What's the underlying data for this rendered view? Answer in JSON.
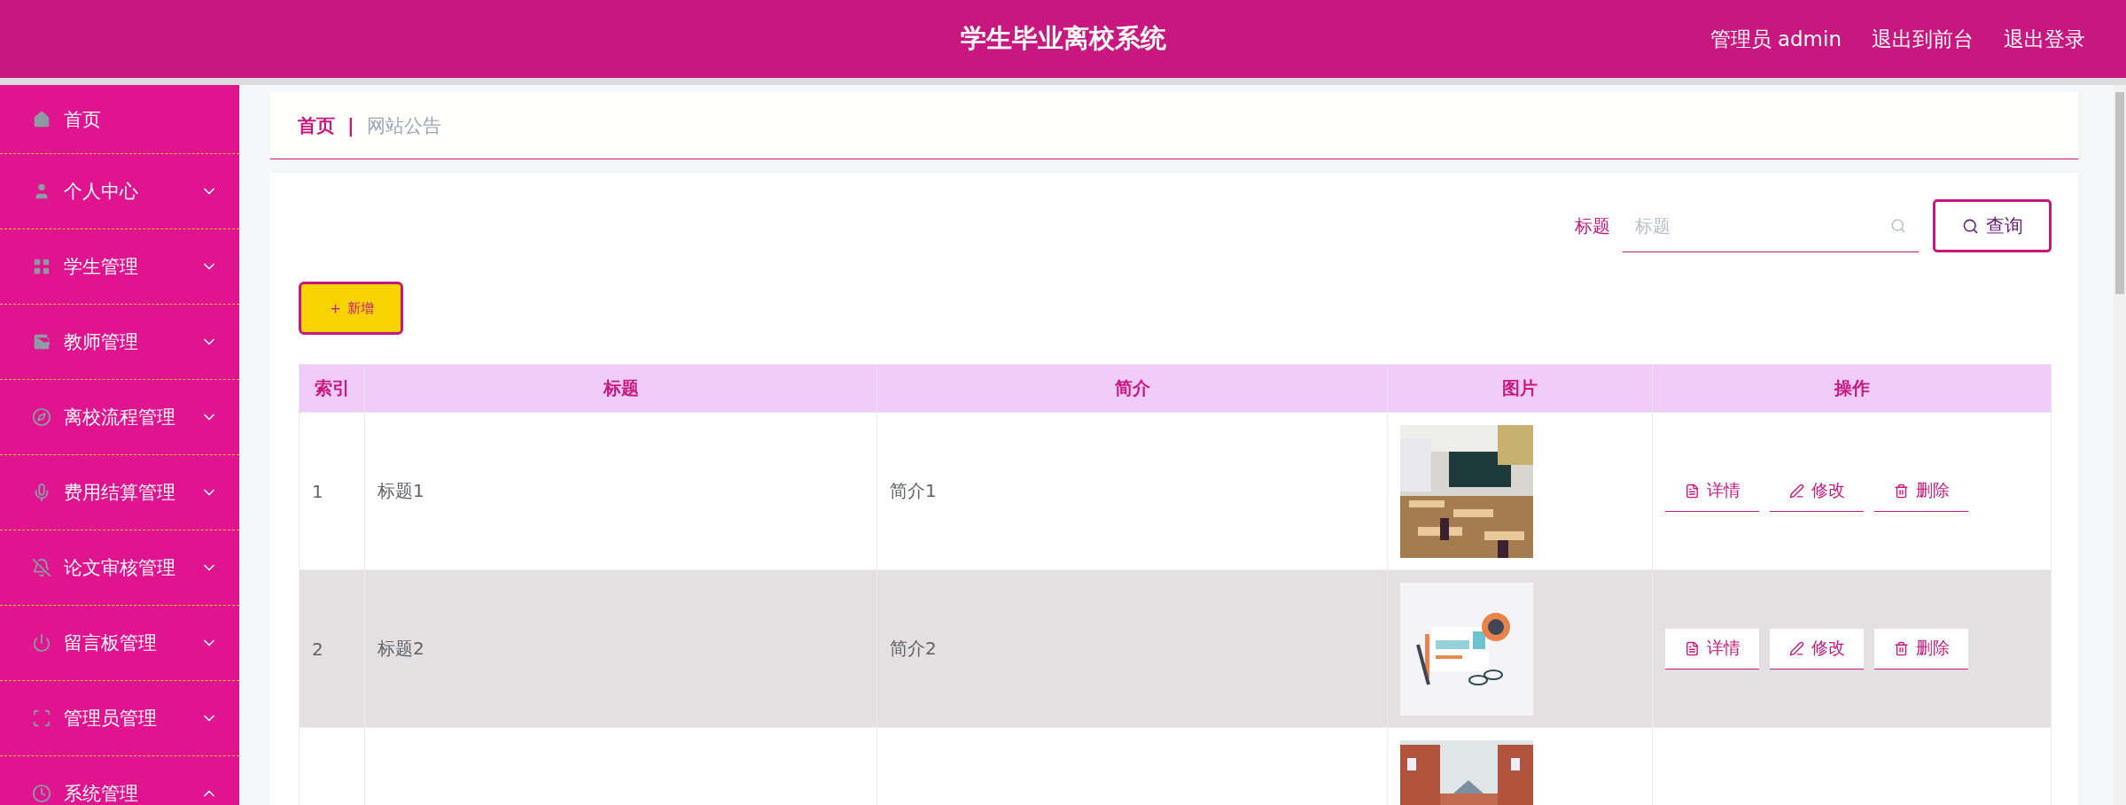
{
  "header": {
    "title": "学生毕业离校系统",
    "links": [
      "管理员 admin",
      "退出到前台",
      "退出登录"
    ]
  },
  "sidebar": {
    "items": [
      {
        "label": "首页",
        "kind": "link"
      },
      {
        "label": "个人中心",
        "kind": "submenu",
        "expanded": false
      },
      {
        "label": "学生管理",
        "kind": "submenu",
        "expanded": false
      },
      {
        "label": "教师管理",
        "kind": "submenu",
        "expanded": false
      },
      {
        "label": "离校流程管理",
        "kind": "submenu",
        "expanded": false
      },
      {
        "label": "费用结算管理",
        "kind": "submenu",
        "expanded": false
      },
      {
        "label": "论文审核管理",
        "kind": "submenu",
        "expanded": false
      },
      {
        "label": "留言板管理",
        "kind": "submenu",
        "expanded": false
      },
      {
        "label": "管理员管理",
        "kind": "submenu",
        "expanded": false
      },
      {
        "label": "系统管理",
        "kind": "submenu",
        "expanded": true
      }
    ]
  },
  "breadcrumb": {
    "home": "首页",
    "separator": "|",
    "current": "网站公告"
  },
  "search": {
    "label": "标题",
    "placeholder": "标题",
    "button": "查询"
  },
  "add_button": "新增",
  "table": {
    "columns": [
      "索引",
      "标题",
      "简介",
      "图片",
      "操作"
    ],
    "rows": [
      {
        "index": "1",
        "title": "标题1",
        "intro": "简介1",
        "selected": false,
        "actions": [
          "详情",
          "修改",
          "删除"
        ]
      },
      {
        "index": "2",
        "title": "标题2",
        "intro": "简介2",
        "selected": true,
        "actions": [
          "详情",
          "修改",
          "删除"
        ]
      },
      {
        "selected": false
      }
    ]
  }
}
